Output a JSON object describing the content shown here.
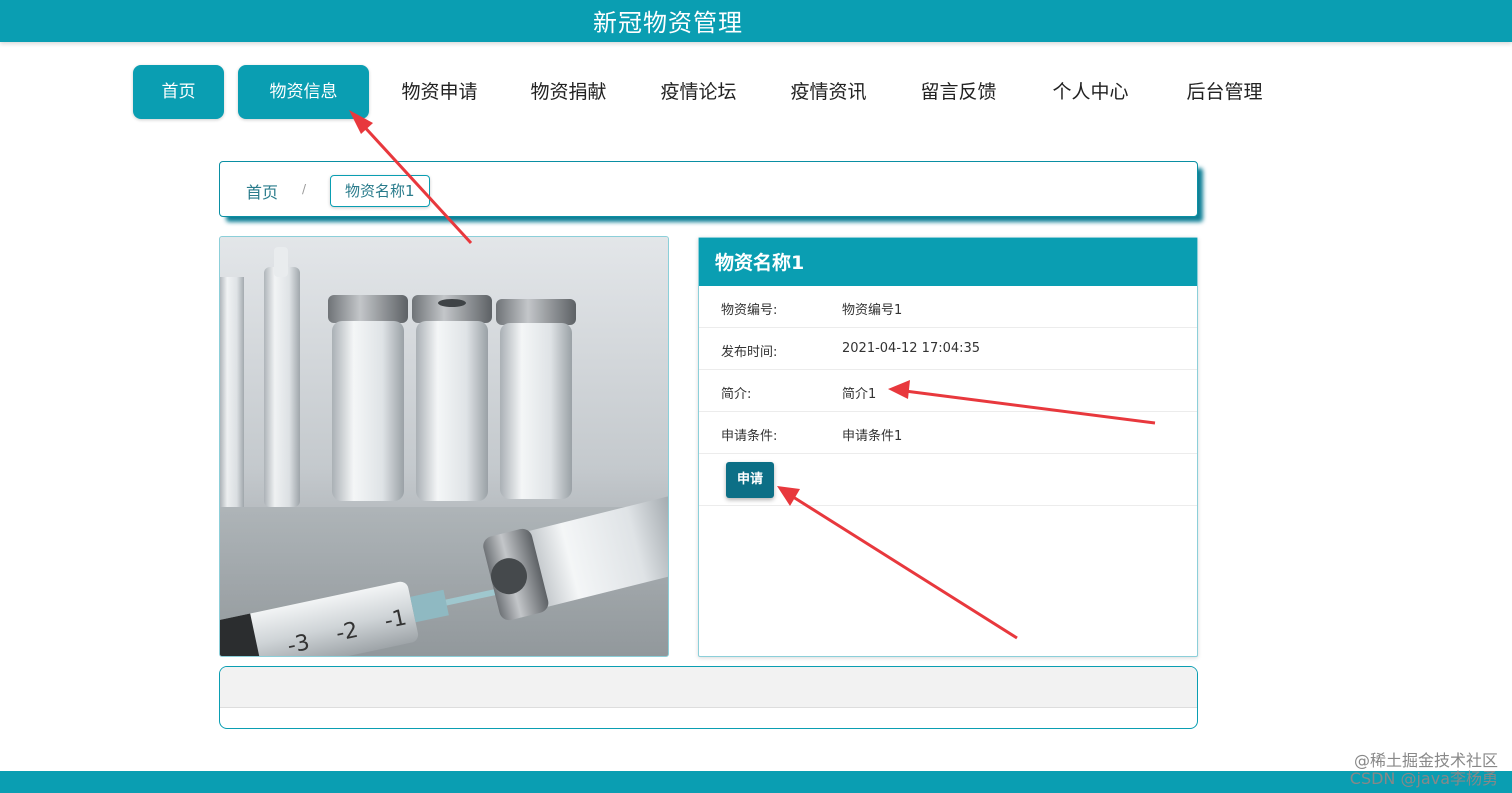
{
  "header": {
    "title": "新冠物资管理"
  },
  "nav": [
    {
      "label": "首页"
    },
    {
      "label": "物资信息"
    },
    {
      "label": "物资申请"
    },
    {
      "label": "物资捐献"
    },
    {
      "label": "疫情论坛"
    },
    {
      "label": "疫情资讯"
    },
    {
      "label": "留言反馈"
    },
    {
      "label": "个人中心"
    },
    {
      "label": "后台管理"
    }
  ],
  "breadcrumb": {
    "home": "首页",
    "separator": "/",
    "current": "物资名称1"
  },
  "detail": {
    "title": "物资名称1",
    "rows": [
      {
        "label": "物资编号:",
        "value": "物资编号1"
      },
      {
        "label": "发布时间:",
        "value": "2021-04-12 17:04:35"
      },
      {
        "label": "简介:",
        "value": "简介1"
      },
      {
        "label": "申请条件:",
        "value": "申请条件1"
      }
    ],
    "apply_label": "申请"
  },
  "watermark": {
    "line1": "@稀土掘金技术社区",
    "line2": "CSDN @java李杨勇"
  },
  "colors": {
    "brand": "#0a9eb2",
    "button": "#0c6f86",
    "annotation": "#e8383d"
  }
}
